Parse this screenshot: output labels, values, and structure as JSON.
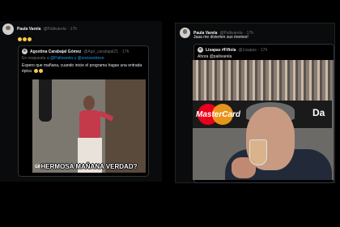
{
  "left_tweet": {
    "name": "Paula Varela",
    "handle": "@Paliivarela",
    "time": "· 17h",
    "emojis": [
      "laughing-face",
      "laughing-face",
      "laughing-face"
    ],
    "quote": {
      "name": "Agostina Carabajal Gómez",
      "handle": "@Ago_carabajal21",
      "time": "· 17h",
      "reply_prefix": "En respuesta a",
      "reply_to": "@Paliivarela y @socioestrece",
      "text": "Espero que mañana, cuando inicie el programa hagas una entrada",
      "text2": "épica",
      "gif_caption": "HERMOSA MAÑANA VERDAD?",
      "gif_badge": "GIF ALT"
    }
  },
  "right_tweet": {
    "name": "Paula Varela",
    "handle": "@Paliivarela",
    "time": "· 17h",
    "text": "Jaaa me divierten sus memes!",
    "quote": {
      "name": "Lisapas #Fifiola",
      "handle": "@Lisapas",
      "time": "· 17h",
      "text": "Ahora @paliivarela",
      "banner_brand": "MasterCard",
      "banner_right": "Da"
    }
  }
}
